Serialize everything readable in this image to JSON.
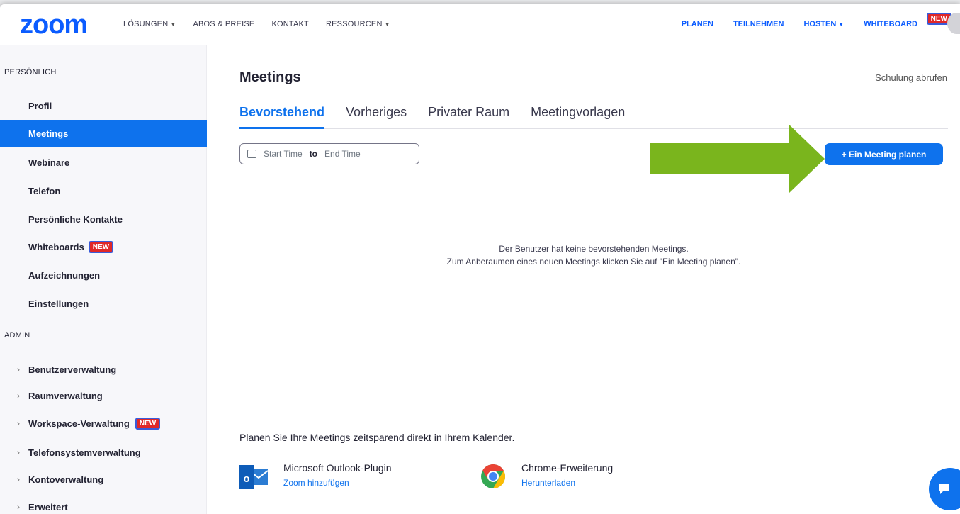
{
  "header": {
    "logo": "zoom",
    "nav_left": [
      {
        "label": "LÖSUNGEN",
        "has_caret": true
      },
      {
        "label": "ABOS & PREISE",
        "has_caret": false
      },
      {
        "label": "KONTAKT",
        "has_caret": false
      },
      {
        "label": "RESSOURCEN",
        "has_caret": true
      }
    ],
    "nav_right": [
      {
        "label": "PLANEN"
      },
      {
        "label": "TEILNEHMEN"
      },
      {
        "label": "HOSTEN"
      },
      {
        "label": "WHITEBOARD",
        "badge": "NEW"
      }
    ]
  },
  "sidebar": {
    "section_personal": "PERSÖNLICH",
    "personal_items": [
      {
        "label": "Profil"
      },
      {
        "label": "Meetings",
        "active": true
      },
      {
        "label": "Webinare"
      },
      {
        "label": "Telefon"
      },
      {
        "label": "Persönliche Kontakte"
      },
      {
        "label": "Whiteboards",
        "badge": "NEW"
      },
      {
        "label": "Aufzeichnungen"
      },
      {
        "label": "Einstellungen"
      }
    ],
    "section_admin": "ADMIN",
    "admin_items": [
      {
        "label": "Benutzerverwaltung"
      },
      {
        "label": "Raumverwaltung"
      },
      {
        "label": "Workspace-Verwaltung",
        "badge": "NEW"
      },
      {
        "label": "Telefonsystemverwaltung"
      },
      {
        "label": "Kontoverwaltung"
      },
      {
        "label": "Erweitert"
      }
    ]
  },
  "main": {
    "title": "Meetings",
    "training_link": "Schulung abrufen",
    "tabs": [
      {
        "label": "Bevorstehend",
        "active": true
      },
      {
        "label": "Vorheriges"
      },
      {
        "label": "Privater Raum"
      },
      {
        "label": "Meetingvorlagen"
      }
    ],
    "date_range": {
      "start": "Start Time",
      "to": "to",
      "end": "End Time"
    },
    "plan_button": "+ Ein Meeting planen",
    "empty_line1": "Der Benutzer hat keine bevorstehenden Meetings.",
    "empty_line2": "Zum Anberaumen eines neuen Meetings klicken Sie auf \"Ein Meeting planen\".",
    "calendar_text": "Planen Sie Ihre Meetings zeitsparend direkt in Ihrem Kalender.",
    "plugins": [
      {
        "name": "Microsoft Outlook-Plugin",
        "link": "Zoom hinzufügen"
      },
      {
        "name": "Chrome-Erweiterung",
        "link": "Herunterladen"
      }
    ]
  },
  "colors": {
    "brand": "#0b5cff",
    "accent": "#0e72ed",
    "arrow": "#7ab51d",
    "badge": "#e02828"
  }
}
